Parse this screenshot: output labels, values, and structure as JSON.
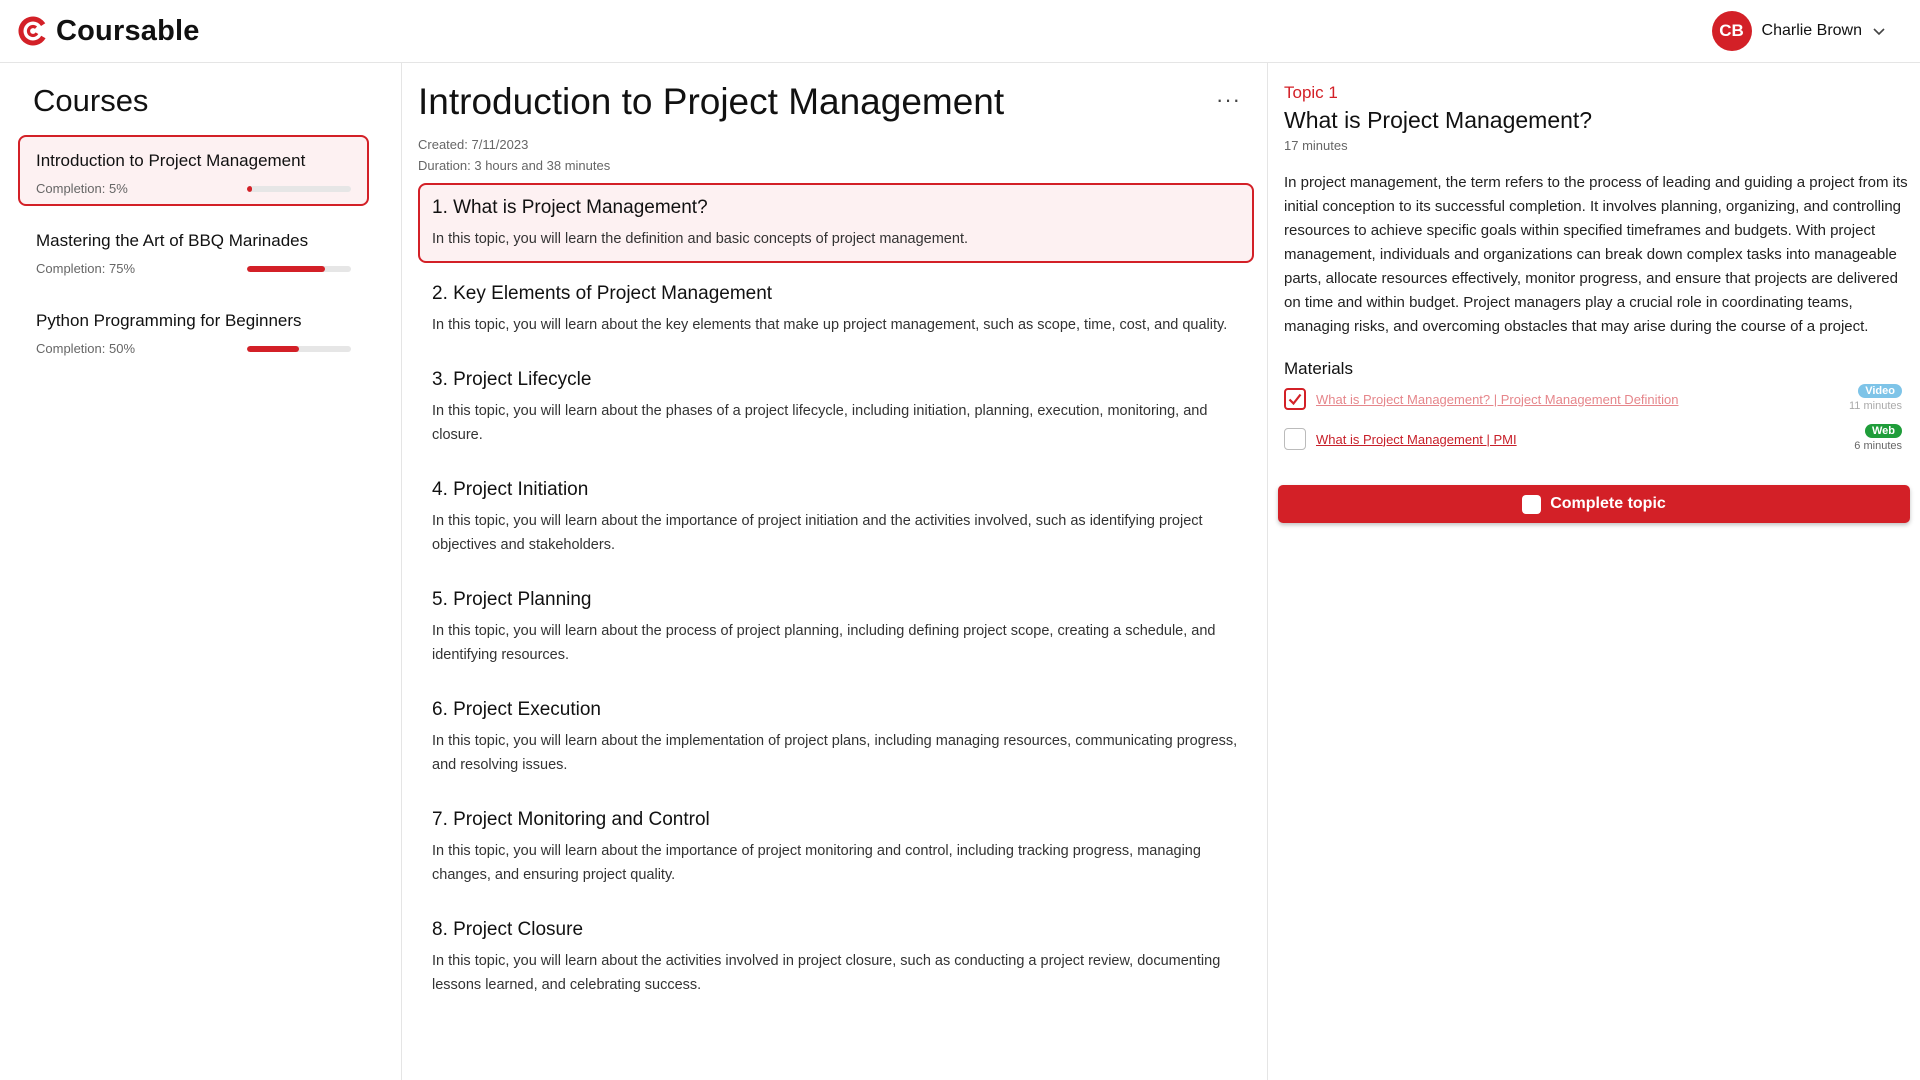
{
  "app": {
    "name": "Coursable",
    "brand_color": "#d32027"
  },
  "user": {
    "initials": "CB",
    "name": "Charlie Brown"
  },
  "sidebar": {
    "title": "Courses",
    "courses": [
      {
        "title": "Introduction to Project Management",
        "completion_label": "Completion: 5%",
        "completion": 5,
        "active": true
      },
      {
        "title": "Mastering the Art of BBQ Marinades",
        "completion_label": "Completion: 75%",
        "completion": 75,
        "active": false
      },
      {
        "title": "Python Programming for Beginners",
        "completion_label": "Completion: 50%",
        "completion": 50,
        "active": false
      }
    ]
  },
  "main": {
    "title": "Introduction to Project Management",
    "more_label": "···",
    "created": "Created: 7/11/2023",
    "duration": "Duration: 3 hours and 38 minutes",
    "topics": [
      {
        "title": "1. What is Project Management?",
        "desc": "In this topic, you will learn the definition and basic concepts of project management."
      },
      {
        "title": "2. Key Elements of Project Management",
        "desc": "In this topic, you will learn about the key elements that make up project management, such as scope, time, cost, and quality."
      },
      {
        "title": "3. Project Lifecycle",
        "desc": "In this topic, you will learn about the phases of a project lifecycle, including initiation, planning, execution, monitoring, and closure."
      },
      {
        "title": "4. Project Initiation",
        "desc": "In this topic, you will learn about the importance of project initiation and the activities involved, such as identifying project objectives and stakeholders."
      },
      {
        "title": "5. Project Planning",
        "desc": "In this topic, you will learn about the process of project planning, including defining project scope, creating a schedule, and identifying resources."
      },
      {
        "title": "6. Project Execution",
        "desc": "In this topic, you will learn about the implementation of project plans, including managing resources, communicating progress, and resolving issues."
      },
      {
        "title": "7. Project Monitoring and Control",
        "desc": "In this topic, you will learn about the importance of project monitoring and control, including tracking progress, managing changes, and ensuring project quality."
      },
      {
        "title": "8. Project Closure",
        "desc": "In this topic, you will learn about the activities involved in project closure, such as conducting a project review, documenting lessons learned, and celebrating success."
      }
    ]
  },
  "detail": {
    "topic_num": "Topic 1",
    "title": "What is Project Management?",
    "duration": "17 minutes",
    "body": "In project management, the term refers to the process of leading and guiding a project from its initial conception to its successful completion. It involves planning, organizing, and controlling resources to achieve specific goals within specified timeframes and budgets. With project management, individuals and organizations can break down complex tasks into manageable parts, allocate resources effectively, monitor progress, and ensure that projects are delivered on time and within budget. Project managers play a crucial role in coordinating teams, managing risks, and overcoming obstacles that may arise during the course of a project.",
    "materials_title": "Materials",
    "materials": [
      {
        "title": "What is Project Management? | Project Management Definition",
        "type": "Video",
        "type_color": "#7ec4e8",
        "minutes": "11 minutes",
        "done": true
      },
      {
        "title": "What is Project Management | PMI",
        "type": "Web",
        "type_color": "#1f9d3a",
        "minutes": "6 minutes",
        "done": false
      }
    ],
    "complete_label": "Complete topic"
  }
}
